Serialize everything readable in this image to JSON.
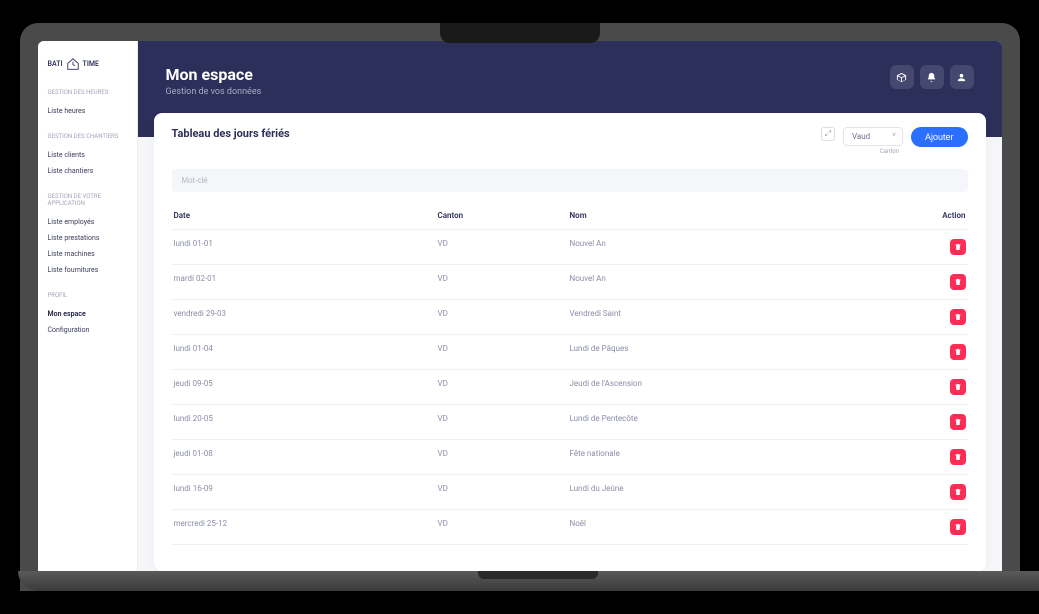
{
  "logo": {
    "text1": "BATI",
    "text2": "TIME"
  },
  "sidebar": {
    "sections": [
      {
        "title": "GESTION DES HEURES",
        "items": [
          {
            "label": "Liste heures",
            "active": false
          }
        ]
      },
      {
        "title": "GESTION DES CHANTIERS",
        "items": [
          {
            "label": "Liste clients",
            "active": false
          },
          {
            "label": "Liste chantiers",
            "active": false
          }
        ]
      },
      {
        "title": "GESTION DE VOTRE APPLICATION",
        "items": [
          {
            "label": "Liste employés",
            "active": false
          },
          {
            "label": "Liste prestations",
            "active": false
          },
          {
            "label": "Liste machines",
            "active": false
          },
          {
            "label": "Liste fournitures",
            "active": false
          }
        ]
      },
      {
        "title": "PROFIL",
        "items": [
          {
            "label": "Mon espace",
            "active": true
          },
          {
            "label": "Configuration",
            "active": false
          }
        ]
      }
    ]
  },
  "header": {
    "title": "Mon espace",
    "subtitle": "Gestion de vos données"
  },
  "card": {
    "title": "Tableau des jours fériés",
    "canton_selected": "Vaud",
    "canton_label": "Canton",
    "add_button": "Ajouter",
    "search_placeholder": "Mot-clé"
  },
  "table": {
    "headers": {
      "date": "Date",
      "canton": "Canton",
      "nom": "Nom",
      "action": "Action"
    },
    "rows": [
      {
        "date": "lundi 01-01",
        "canton": "VD",
        "nom": "Nouvel An"
      },
      {
        "date": "mardi 02-01",
        "canton": "VD",
        "nom": "Nouvel An"
      },
      {
        "date": "vendredi 29-03",
        "canton": "VD",
        "nom": "Vendredi Saint"
      },
      {
        "date": "lundi 01-04",
        "canton": "VD",
        "nom": "Lundi de Pâques"
      },
      {
        "date": "jeudi 09-05",
        "canton": "VD",
        "nom": "Jeudi de l'Ascension"
      },
      {
        "date": "lundi 20-05",
        "canton": "VD",
        "nom": "Lundi de Pentecôte"
      },
      {
        "date": "jeudi 01-08",
        "canton": "VD",
        "nom": "Fête nationale"
      },
      {
        "date": "lundi 16-09",
        "canton": "VD",
        "nom": "Lundi du Jeûne"
      },
      {
        "date": "mercredi 25-12",
        "canton": "VD",
        "nom": "Noël"
      }
    ]
  }
}
